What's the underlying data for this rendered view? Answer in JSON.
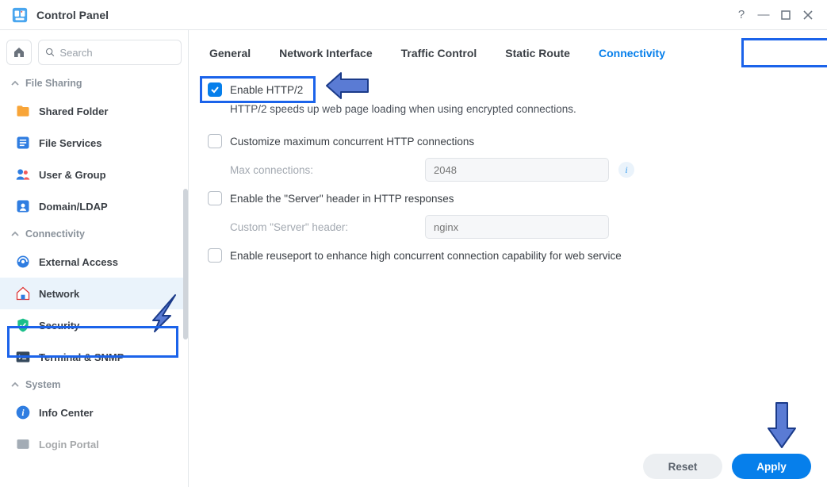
{
  "window": {
    "title": "Control Panel"
  },
  "search": {
    "placeholder": "Search"
  },
  "sidebar": {
    "sections": [
      {
        "label": "File Sharing"
      },
      {
        "label": "Connectivity"
      },
      {
        "label": "System"
      }
    ],
    "items": {
      "shared_folder": "Shared Folder",
      "file_services": "File Services",
      "user_group": "User & Group",
      "domain_ldap": "Domain/LDAP",
      "external_access": "External Access",
      "network": "Network",
      "security": "Security",
      "terminal_snmp": "Terminal & SNMP",
      "info_center": "Info Center",
      "login_portal": "Login Portal"
    }
  },
  "tabs": {
    "general": "General",
    "network_interface": "Network Interface",
    "traffic_control": "Traffic Control",
    "static_route": "Static Route",
    "connectivity": "Connectivity"
  },
  "pane": {
    "enable_http2": "Enable HTTP/2",
    "http2_desc": "HTTP/2 speeds up web page loading when using encrypted connections.",
    "customize_max": "Customize maximum concurrent HTTP connections",
    "max_conn_label": "Max connections:",
    "max_conn_value": "2048",
    "enable_server_header": "Enable the \"Server\" header in HTTP responses",
    "custom_server_label": "Custom \"Server\" header:",
    "custom_server_value": "nginx",
    "enable_reuseport": "Enable reuseport to enhance high concurrent connection capability for web service",
    "info_tooltip": "i"
  },
  "buttons": {
    "reset": "Reset",
    "apply": "Apply"
  }
}
